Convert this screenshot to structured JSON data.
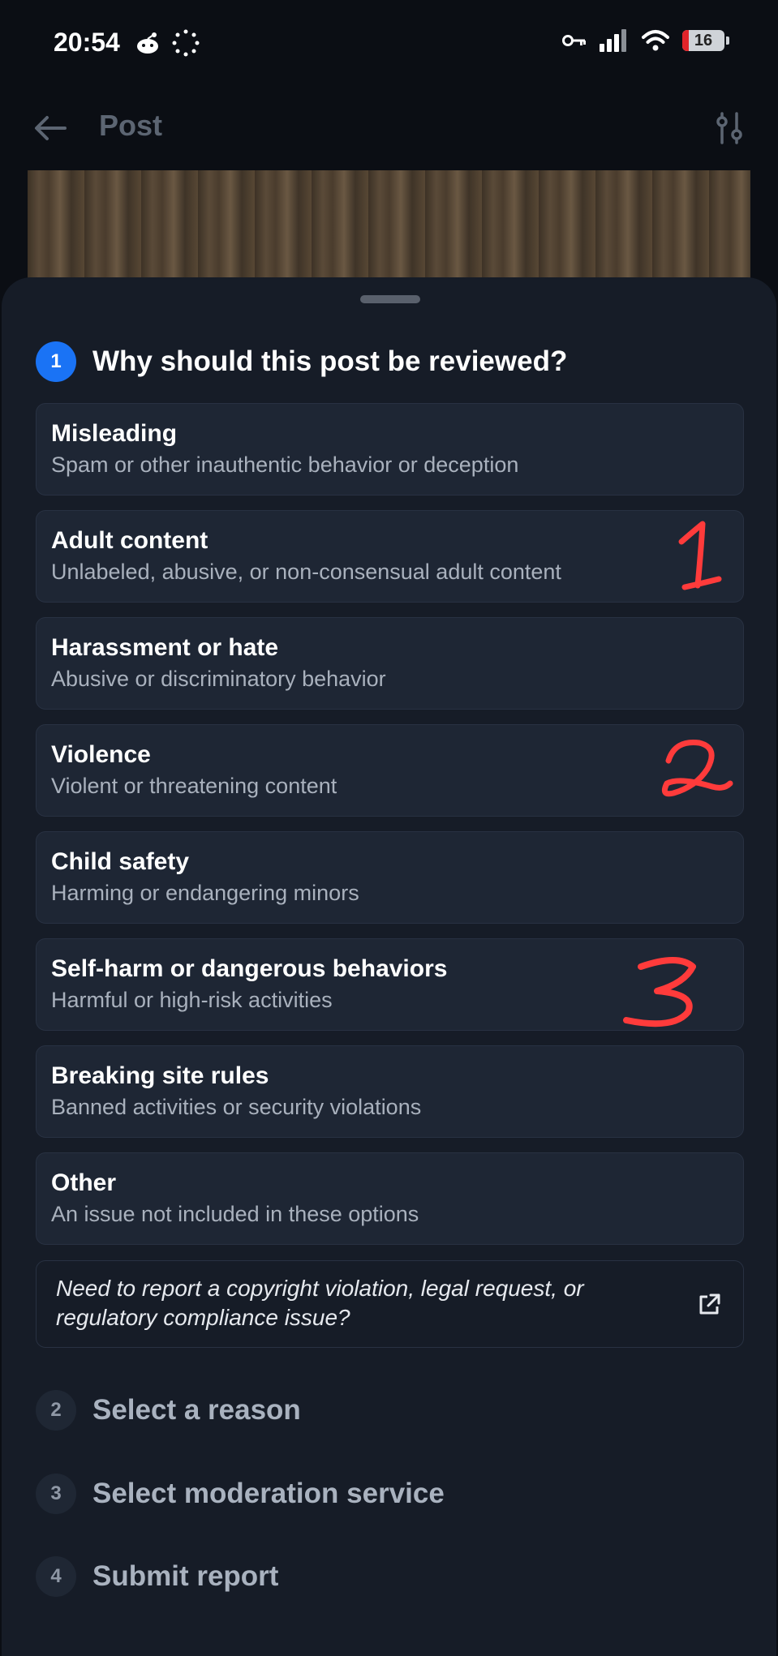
{
  "status_bar": {
    "time": "20:54",
    "battery": "16"
  },
  "header": {
    "title": "Post"
  },
  "sheet": {
    "steps": [
      {
        "number": "1",
        "title": "Why should this post be reviewed?"
      },
      {
        "number": "2",
        "title": "Select a reason"
      },
      {
        "number": "3",
        "title": "Select moderation service"
      },
      {
        "number": "4",
        "title": "Submit report"
      }
    ],
    "options": [
      {
        "title": "Misleading",
        "desc": "Spam or other inauthentic behavior or deception"
      },
      {
        "title": "Adult content",
        "desc": "Unlabeled, abusive, or non-consensual adult content"
      },
      {
        "title": "Harassment or hate",
        "desc": "Abusive or discriminatory behavior"
      },
      {
        "title": "Violence",
        "desc": "Violent or threatening content"
      },
      {
        "title": "Child safety",
        "desc": "Harming or endangering minors"
      },
      {
        "title": "Self-harm or dangerous behaviors",
        "desc": "Harmful or high-risk activities"
      },
      {
        "title": "Breaking site rules",
        "desc": "Banned activities or security violations"
      },
      {
        "title": "Other",
        "desc": "An issue not included in these options"
      }
    ],
    "copyright_text": "Need to report a copyright violation, legal request, or regulatory compliance issue?"
  },
  "colors": {
    "accent": "#1a73f5",
    "annotation": "#ff3b3b"
  }
}
